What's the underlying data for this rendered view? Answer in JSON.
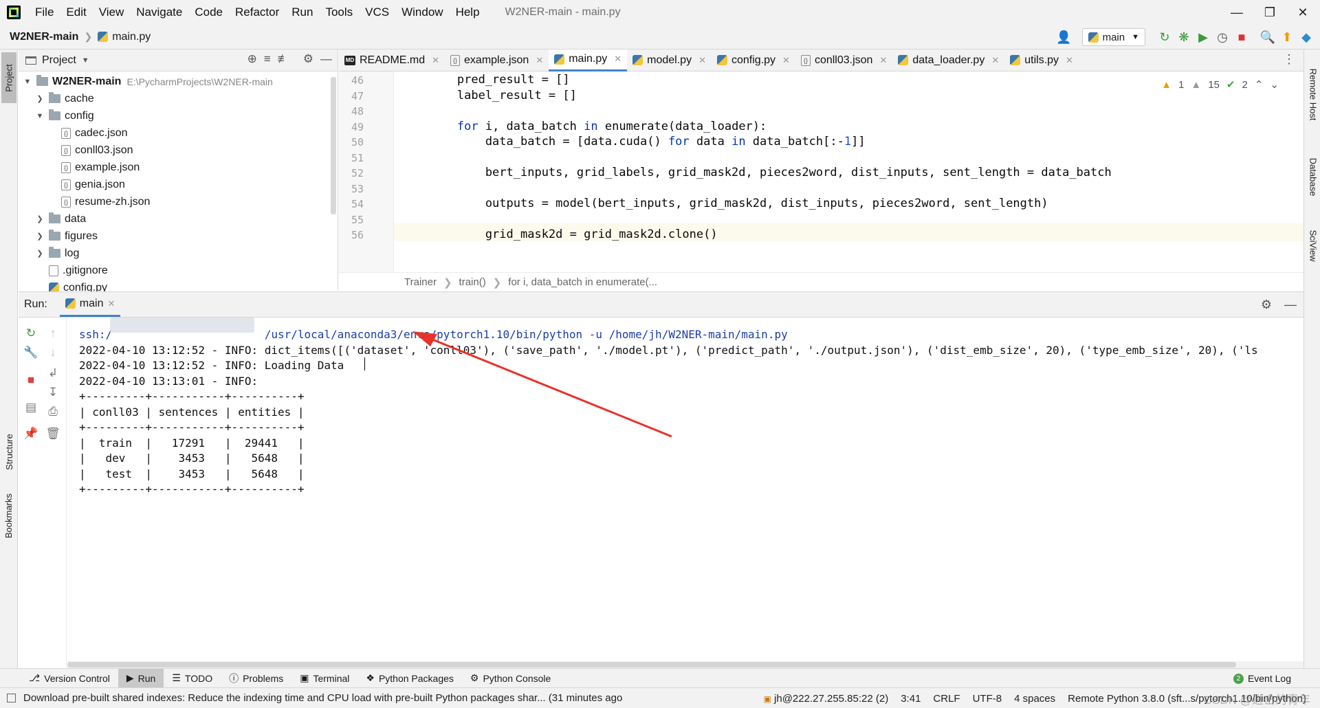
{
  "menu": [
    "File",
    "Edit",
    "View",
    "Navigate",
    "Code",
    "Refactor",
    "Run",
    "Tools",
    "VCS",
    "Window",
    "Help"
  ],
  "window_title": "W2NER-main - main.py",
  "nav": {
    "project": "W2NER-main",
    "file": "main.py",
    "run_config": "main"
  },
  "project_panel": {
    "title": "Project",
    "root_name": "W2NER-main",
    "root_path": "E:\\PycharmProjects\\W2NER-main",
    "items": [
      {
        "label": "cache",
        "type": "folder",
        "expanded": false,
        "depth": 1
      },
      {
        "label": "config",
        "type": "folder",
        "expanded": true,
        "depth": 1
      },
      {
        "label": "cadec.json",
        "type": "json",
        "depth": 2
      },
      {
        "label": "conll03.json",
        "type": "json",
        "depth": 2
      },
      {
        "label": "example.json",
        "type": "json",
        "depth": 2
      },
      {
        "label": "genia.json",
        "type": "json",
        "depth": 2
      },
      {
        "label": "resume-zh.json",
        "type": "json",
        "depth": 2
      },
      {
        "label": "data",
        "type": "folder",
        "expanded": false,
        "depth": 1
      },
      {
        "label": "figures",
        "type": "folder",
        "expanded": false,
        "depth": 1
      },
      {
        "label": "log",
        "type": "folder",
        "expanded": false,
        "depth": 1
      },
      {
        "label": ".gitignore",
        "type": "file",
        "depth": 1
      },
      {
        "label": "config.py",
        "type": "py",
        "depth": 1
      }
    ]
  },
  "editor_tabs": [
    {
      "label": "README.md",
      "icon": "md"
    },
    {
      "label": "example.json",
      "icon": "json"
    },
    {
      "label": "main.py",
      "icon": "py",
      "active": true
    },
    {
      "label": "model.py",
      "icon": "py"
    },
    {
      "label": "config.py",
      "icon": "py"
    },
    {
      "label": "conll03.json",
      "icon": "json"
    },
    {
      "label": "data_loader.py",
      "icon": "py"
    },
    {
      "label": "utils.py",
      "icon": "py"
    }
  ],
  "inspections": {
    "warnings": "1",
    "weak_warnings": "15",
    "typos": "2"
  },
  "code_lines": [
    {
      "num": "46",
      "html": "        pred_result = []"
    },
    {
      "num": "47",
      "html": "        label_result = []"
    },
    {
      "num": "48",
      "html": ""
    },
    {
      "num": "49",
      "html": "        <span class=\"kw\">for</span> i, data_batch <span class=\"kw\">in</span> enumerate(data_loader):"
    },
    {
      "num": "50",
      "html": "            data_batch = [data.cuda() <span class=\"kw\">for</span> data <span class=\"kw\">in</span> data_batch[:-<span class=\"num\">1</span>]]"
    },
    {
      "num": "51",
      "html": ""
    },
    {
      "num": "52",
      "html": "            bert_inputs, grid_labels, grid_mask2d, pieces2word, dist_inputs, sent_length = data_batch"
    },
    {
      "num": "53",
      "html": ""
    },
    {
      "num": "54",
      "html": "            outputs = model(bert_inputs, grid_mask2d, dist_inputs, pieces2word, sent_length)"
    },
    {
      "num": "55",
      "html": ""
    },
    {
      "num": "56",
      "html": "            grid_mask2d = grid_mask2d.clone()"
    }
  ],
  "breadcrumbs": [
    "Trainer",
    "train()",
    "for i, data_batch in enumerate(..."
  ],
  "run": {
    "label": "Run:",
    "tab": "main",
    "lines": [
      {
        "text": "ssh:/                       /usr/local/anaconda3/envs/pytorch1.10/bin/python -u /home/jh/W2NER-main/main.py",
        "cls": "cmd"
      },
      {
        "text": "2022-04-10 13:12:52 - INFO: dict_items([('dataset', 'conll03'), ('save_path', './model.pt'), ('predict_path', './output.json'), ('dist_emb_size', 20), ('type_emb_size', 20), ('ls",
        "cls": ""
      },
      {
        "text": "2022-04-10 13:12:52 - INFO: Loading Data",
        "cls": ""
      },
      {
        "text": "2022-04-10 13:13:01 - INFO: ",
        "cls": ""
      },
      {
        "text": "+---------+-----------+----------+",
        "cls": ""
      },
      {
        "text": "| conll03 | sentences | entities |",
        "cls": ""
      },
      {
        "text": "+---------+-----------+----------+",
        "cls": ""
      },
      {
        "text": "|  train  |   17291   |  29441   |",
        "cls": ""
      },
      {
        "text": "|   dev   |    3453   |   5648   |",
        "cls": ""
      },
      {
        "text": "|   test  |    3453   |   5648   |",
        "cls": ""
      },
      {
        "text": "+---------+-----------+----------+",
        "cls": ""
      }
    ]
  },
  "bottom_tools": [
    {
      "label": "Version Control",
      "icon": "branch-icon"
    },
    {
      "label": "Run",
      "icon": "run-icon",
      "active": true
    },
    {
      "label": "TODO",
      "icon": "list-icon"
    },
    {
      "label": "Problems",
      "icon": "info-icon"
    },
    {
      "label": "Terminal",
      "icon": "terminal-icon"
    },
    {
      "label": "Python Packages",
      "icon": "packages-icon"
    },
    {
      "label": "Python Console",
      "icon": "python-console-icon"
    }
  ],
  "event_log": "Event Log",
  "event_log_count": "2",
  "status": {
    "message": "Download pre-built shared indexes: Reduce the indexing time and CPU load with pre-built Python packages shar... (31 minutes ago",
    "host": "jh@222.27.255.85:22 (2)",
    "position": "3:41",
    "line_sep": "CRLF",
    "encoding": "UTF-8",
    "indent": "4 spaces",
    "interpreter": "Remote Python 3.8.0 (sft...s/pytorch1.10/bin/python)"
  },
  "side_tabs": {
    "left_top": "Project",
    "left_mid": "Structure",
    "left_bottom": "Bookmarks",
    "right": [
      "Remote Host",
      "Database",
      "SciView"
    ]
  },
  "watermark": "CSDN @进击的青年",
  "colors": {
    "accent": "#4083c9",
    "keyword": "#0033b3",
    "number": "#1750eb",
    "arrow": "#e8322b"
  }
}
